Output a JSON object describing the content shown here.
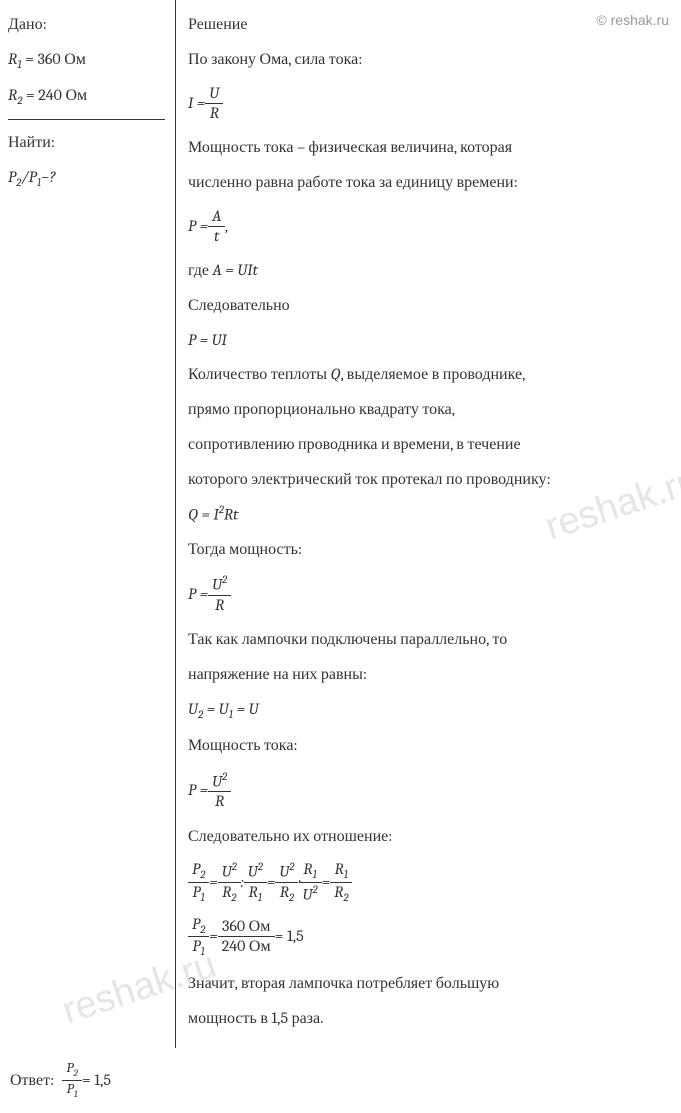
{
  "watermark": {
    "top": "© reshak.ru",
    "mid": "reshak.ru",
    "bot": "reshak.ru"
  },
  "given": {
    "title": "Дано:",
    "r1_label": "R",
    "r1_sub": "1",
    "r1_eq": " = 360 Ом",
    "r2_label": "R",
    "r2_sub": "2",
    "r2_eq": " = 240 Ом"
  },
  "find": {
    "title": "Найти:",
    "expr_p2": "P",
    "expr_sub2": "2",
    "expr_slash": "/",
    "expr_p1": "P",
    "expr_sub1": "1",
    "expr_q": "−?"
  },
  "solution": {
    "title": "Решение",
    "ohm_text": "По закону Ома, сила тока:",
    "eq_I": "I = ",
    "frac_U": "U",
    "frac_R": "R",
    "power_text1": "Мощность тока – физическая величина, которая",
    "power_text2": "численно равна работе тока за единицу времени:",
    "eq_P_At": "P = ",
    "frac_A": "A",
    "frac_t": "t",
    "comma": ",",
    "where_A": "где A = UIt",
    "therefore": "Следовательно",
    "eq_P_UI": "P = UI",
    "heat1": "Количество теплоты Q, выделяемое в проводнике,",
    "heat2": "прямо пропорционально квадрату тока,",
    "heat3": "сопротивлению проводника и времени, в течение",
    "heat4": "которого электрический ток протекал по проводнику:",
    "eq_Q": "Q = I",
    "eq_Q_sup": "2",
    "eq_Q_rest": "Rt",
    "then_power": "Тогда мощность:",
    "eq_P_U2R": "P = ",
    "frac_U2_num": "U",
    "frac_U2_sup": "2",
    "parallel1": "Так как лампочки подключены параллельно, то",
    "parallel2": "напряжение на них равны:",
    "eq_U": "U",
    "eq_U_sub2": "2",
    "eq_U_mid": " = U",
    "eq_U_sub1": "1",
    "eq_U_end": " = U",
    "power_current": "Мощность тока:",
    "therefore_ratio": "Следовательно их отношение:",
    "ratio_P2": "P",
    "ratio_sub2": "2",
    "ratio_P1": "P",
    "ratio_sub1": "1",
    "ratio_eq": " = ",
    "ratio_colon": ": ",
    "ratio_dot": " · ",
    "ratio_R1": "R",
    "ratio_R2": "R",
    "calc_360": "360 Ом",
    "calc_240": "240 Ом",
    "calc_result": " = 1,5",
    "conclusion1": "Значит, вторая лампочка потребляет большую",
    "conclusion2": "мощность в 1,5 раза."
  },
  "answer": {
    "label": "Ответ: ",
    "result": " = 1,5"
  }
}
